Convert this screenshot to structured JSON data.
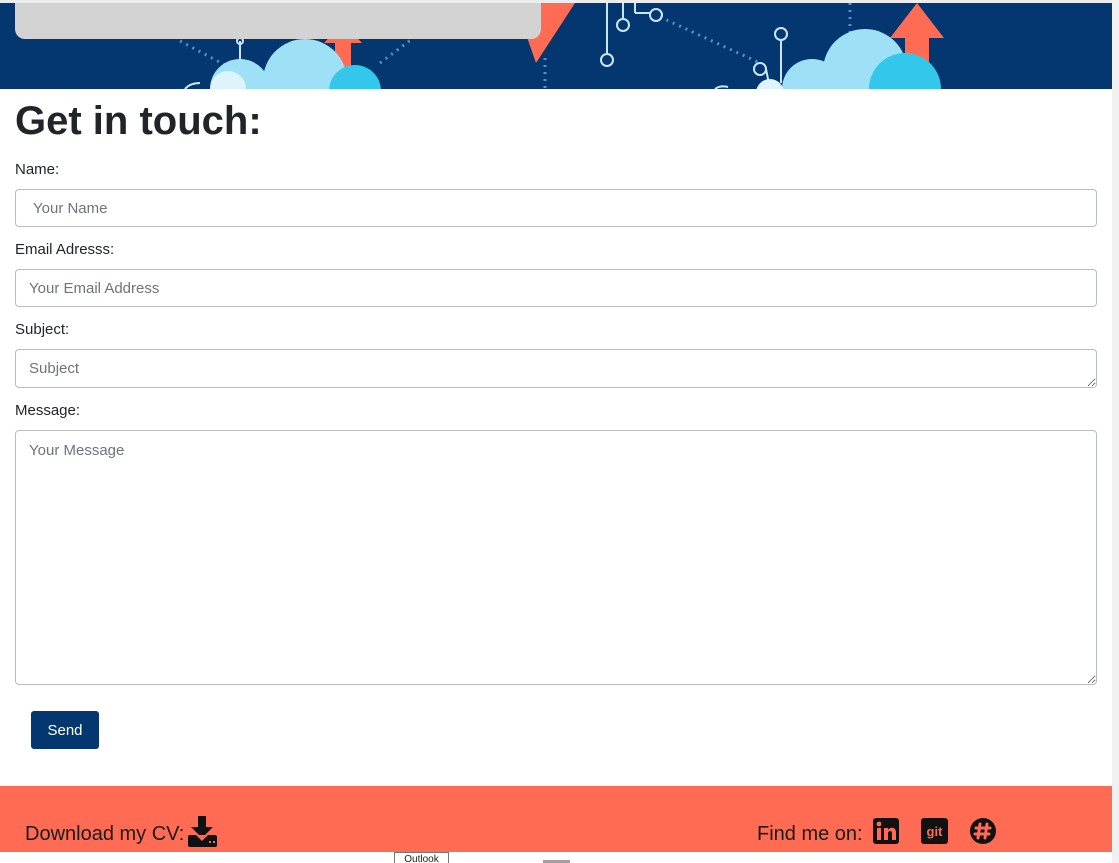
{
  "form": {
    "title": "Get in touch:",
    "name_label": "Name:",
    "name_placeholder": "Your Name",
    "email_label": "Email Adresss:",
    "email_placeholder": "Your Email Address",
    "subject_label": "Subject:",
    "subject_placeholder": "Subject",
    "message_label": "Message:",
    "message_placeholder": "Your Message",
    "send_label": "Send"
  },
  "footer": {
    "cv_text": "Download my CV:",
    "find_text": "Find me on:",
    "icons": [
      "download-icon",
      "linkedin-icon",
      "git-icon",
      "slack-icon"
    ]
  },
  "tooltip": {
    "text": "Outlook"
  },
  "colors": {
    "primary": "#04376f",
    "footer": "#ff6b53",
    "arrow": "#ff6b53",
    "cloud": "#9ee0f5"
  }
}
